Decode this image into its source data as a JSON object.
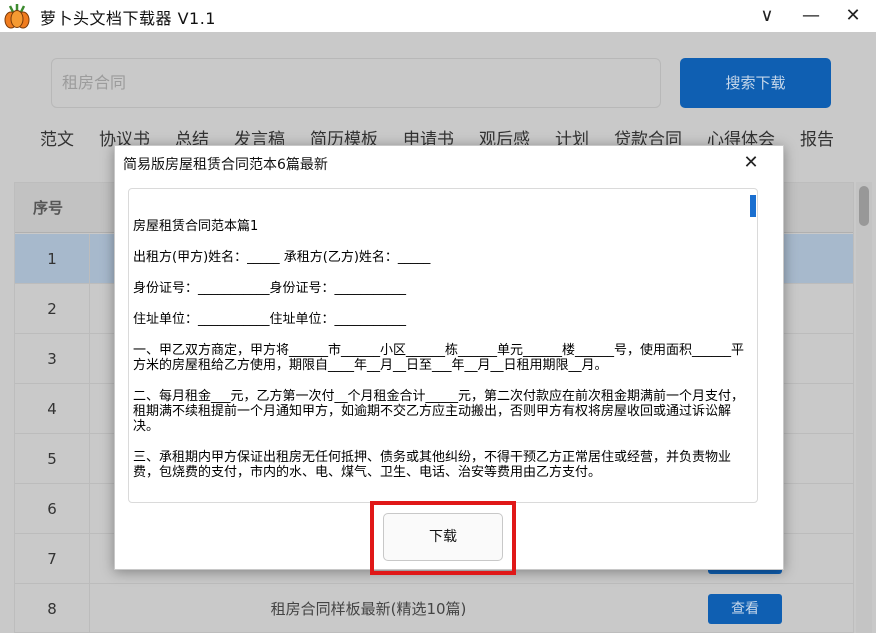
{
  "window": {
    "title": "萝卜头文档下载器  V1.1",
    "minimize_glyph": "∨",
    "maximize_glyph": "—",
    "close_glyph": "✕"
  },
  "search": {
    "value": "租房合同",
    "button_label": "搜索下载"
  },
  "categories": [
    "范文",
    "协议书",
    "总结",
    "发言稿",
    "简历模板",
    "申请书",
    "观后感",
    "计划",
    "贷款合同",
    "心得体会",
    "报告"
  ],
  "table": {
    "header_no": "序号",
    "rows": [
      {
        "no": "1",
        "title": ""
      },
      {
        "no": "2",
        "title": ""
      },
      {
        "no": "3",
        "title": ""
      },
      {
        "no": "4",
        "title": ""
      },
      {
        "no": "5",
        "title": ""
      },
      {
        "no": "6",
        "title": ""
      },
      {
        "no": "7",
        "title": ""
      },
      {
        "no": "8",
        "title": "租房合同样板最新(精选10篇)",
        "button": "查看"
      }
    ]
  },
  "dialog": {
    "title": "简易版房屋租赁合同范本6篇最新",
    "close_glyph": "✕",
    "paragraphs": [
      "房屋租赁合同范本篇1",
      "出租方(甲方)姓名：_____  承租方(乙方)姓名：_____",
      "身份证号：___________身份证号：___________",
      "住址单位：___________住址单位：___________",
      "一、甲乙双方商定，甲方将______市______小区______栋______单元______楼______号，使用面积______平方米的房屋租给乙方使用，期限自____年__月__日至___年__月__日租用期限__月。",
      "二、每月租金___元，乙方第一次付__个月租金合计_____元，第二次付款应在前次租金期满前一个月支付，租期满不续租提前一个月通知甲方，如逾期不交乙方应主动搬出，否则甲方有权将房屋收回或通过诉讼解决。",
      "三、承租期内甲方保证出租房无任何抵押、债务或其他纠纷，不得干预乙方正常居住或经营，并负责物业费，包烧费的支付，市内的水、电、煤气、卫生、电话、治安等费用由乙方支付。"
    ],
    "download_label": "下载"
  },
  "colors": {
    "accent": "#1a6fd0",
    "highlight": "#e01818"
  }
}
